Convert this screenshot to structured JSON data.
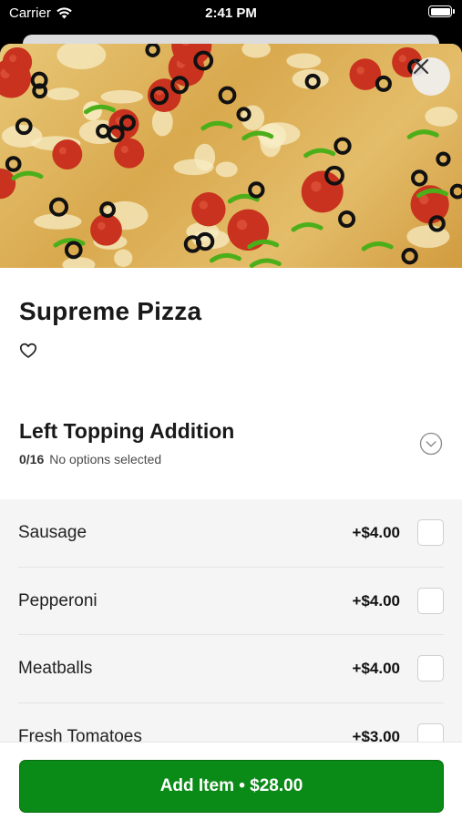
{
  "status_bar": {
    "carrier": "Carrier",
    "time": "2:41 PM"
  },
  "item": {
    "name": "Supreme Pizza"
  },
  "section": {
    "title": "Left Topping Addition",
    "count": "0/16",
    "status": "No options selected"
  },
  "options": [
    {
      "label": "Sausage",
      "price": "+$4.00"
    },
    {
      "label": "Pepperoni",
      "price": "+$4.00"
    },
    {
      "label": "Meatballs",
      "price": "+$4.00"
    },
    {
      "label": "Fresh Tomatoes",
      "price": "+$3.00"
    }
  ],
  "footer": {
    "add_label": "Add Item • $28.00"
  },
  "colors": {
    "accent": "#0a8a16",
    "pepperoni": "#c8321e",
    "olive": "#111111",
    "pepper": "#4caf1a"
  },
  "icons": [
    "wifi-icon",
    "battery-icon",
    "close-icon",
    "heart-icon",
    "chevron-down-icon"
  ]
}
